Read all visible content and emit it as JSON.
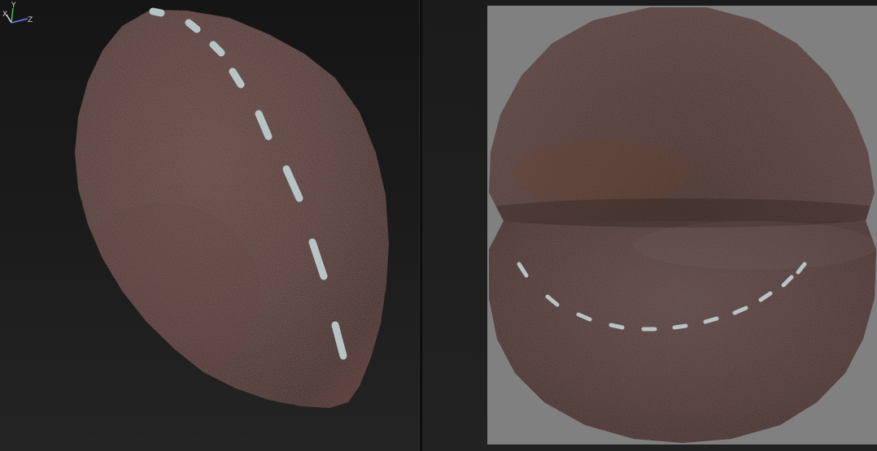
{
  "viewports": {
    "perspective": {
      "object": "football-mesh",
      "material": {
        "leather_color": "#4a3431",
        "leather_highlight": "#6e4a47",
        "stitch_color": "#b7c4c6"
      },
      "axis_gizmo": {
        "x_label": "X",
        "y_label": "Y",
        "z_label": "Z",
        "x_color": "#d9d9d9",
        "y_color": "#4fbf4f",
        "z_color": "#6f7cff"
      }
    },
    "uv_preview": {
      "background_color": "#808080",
      "leather_color": "#4d3836",
      "stitch_color": "#b9c3c5"
    }
  }
}
